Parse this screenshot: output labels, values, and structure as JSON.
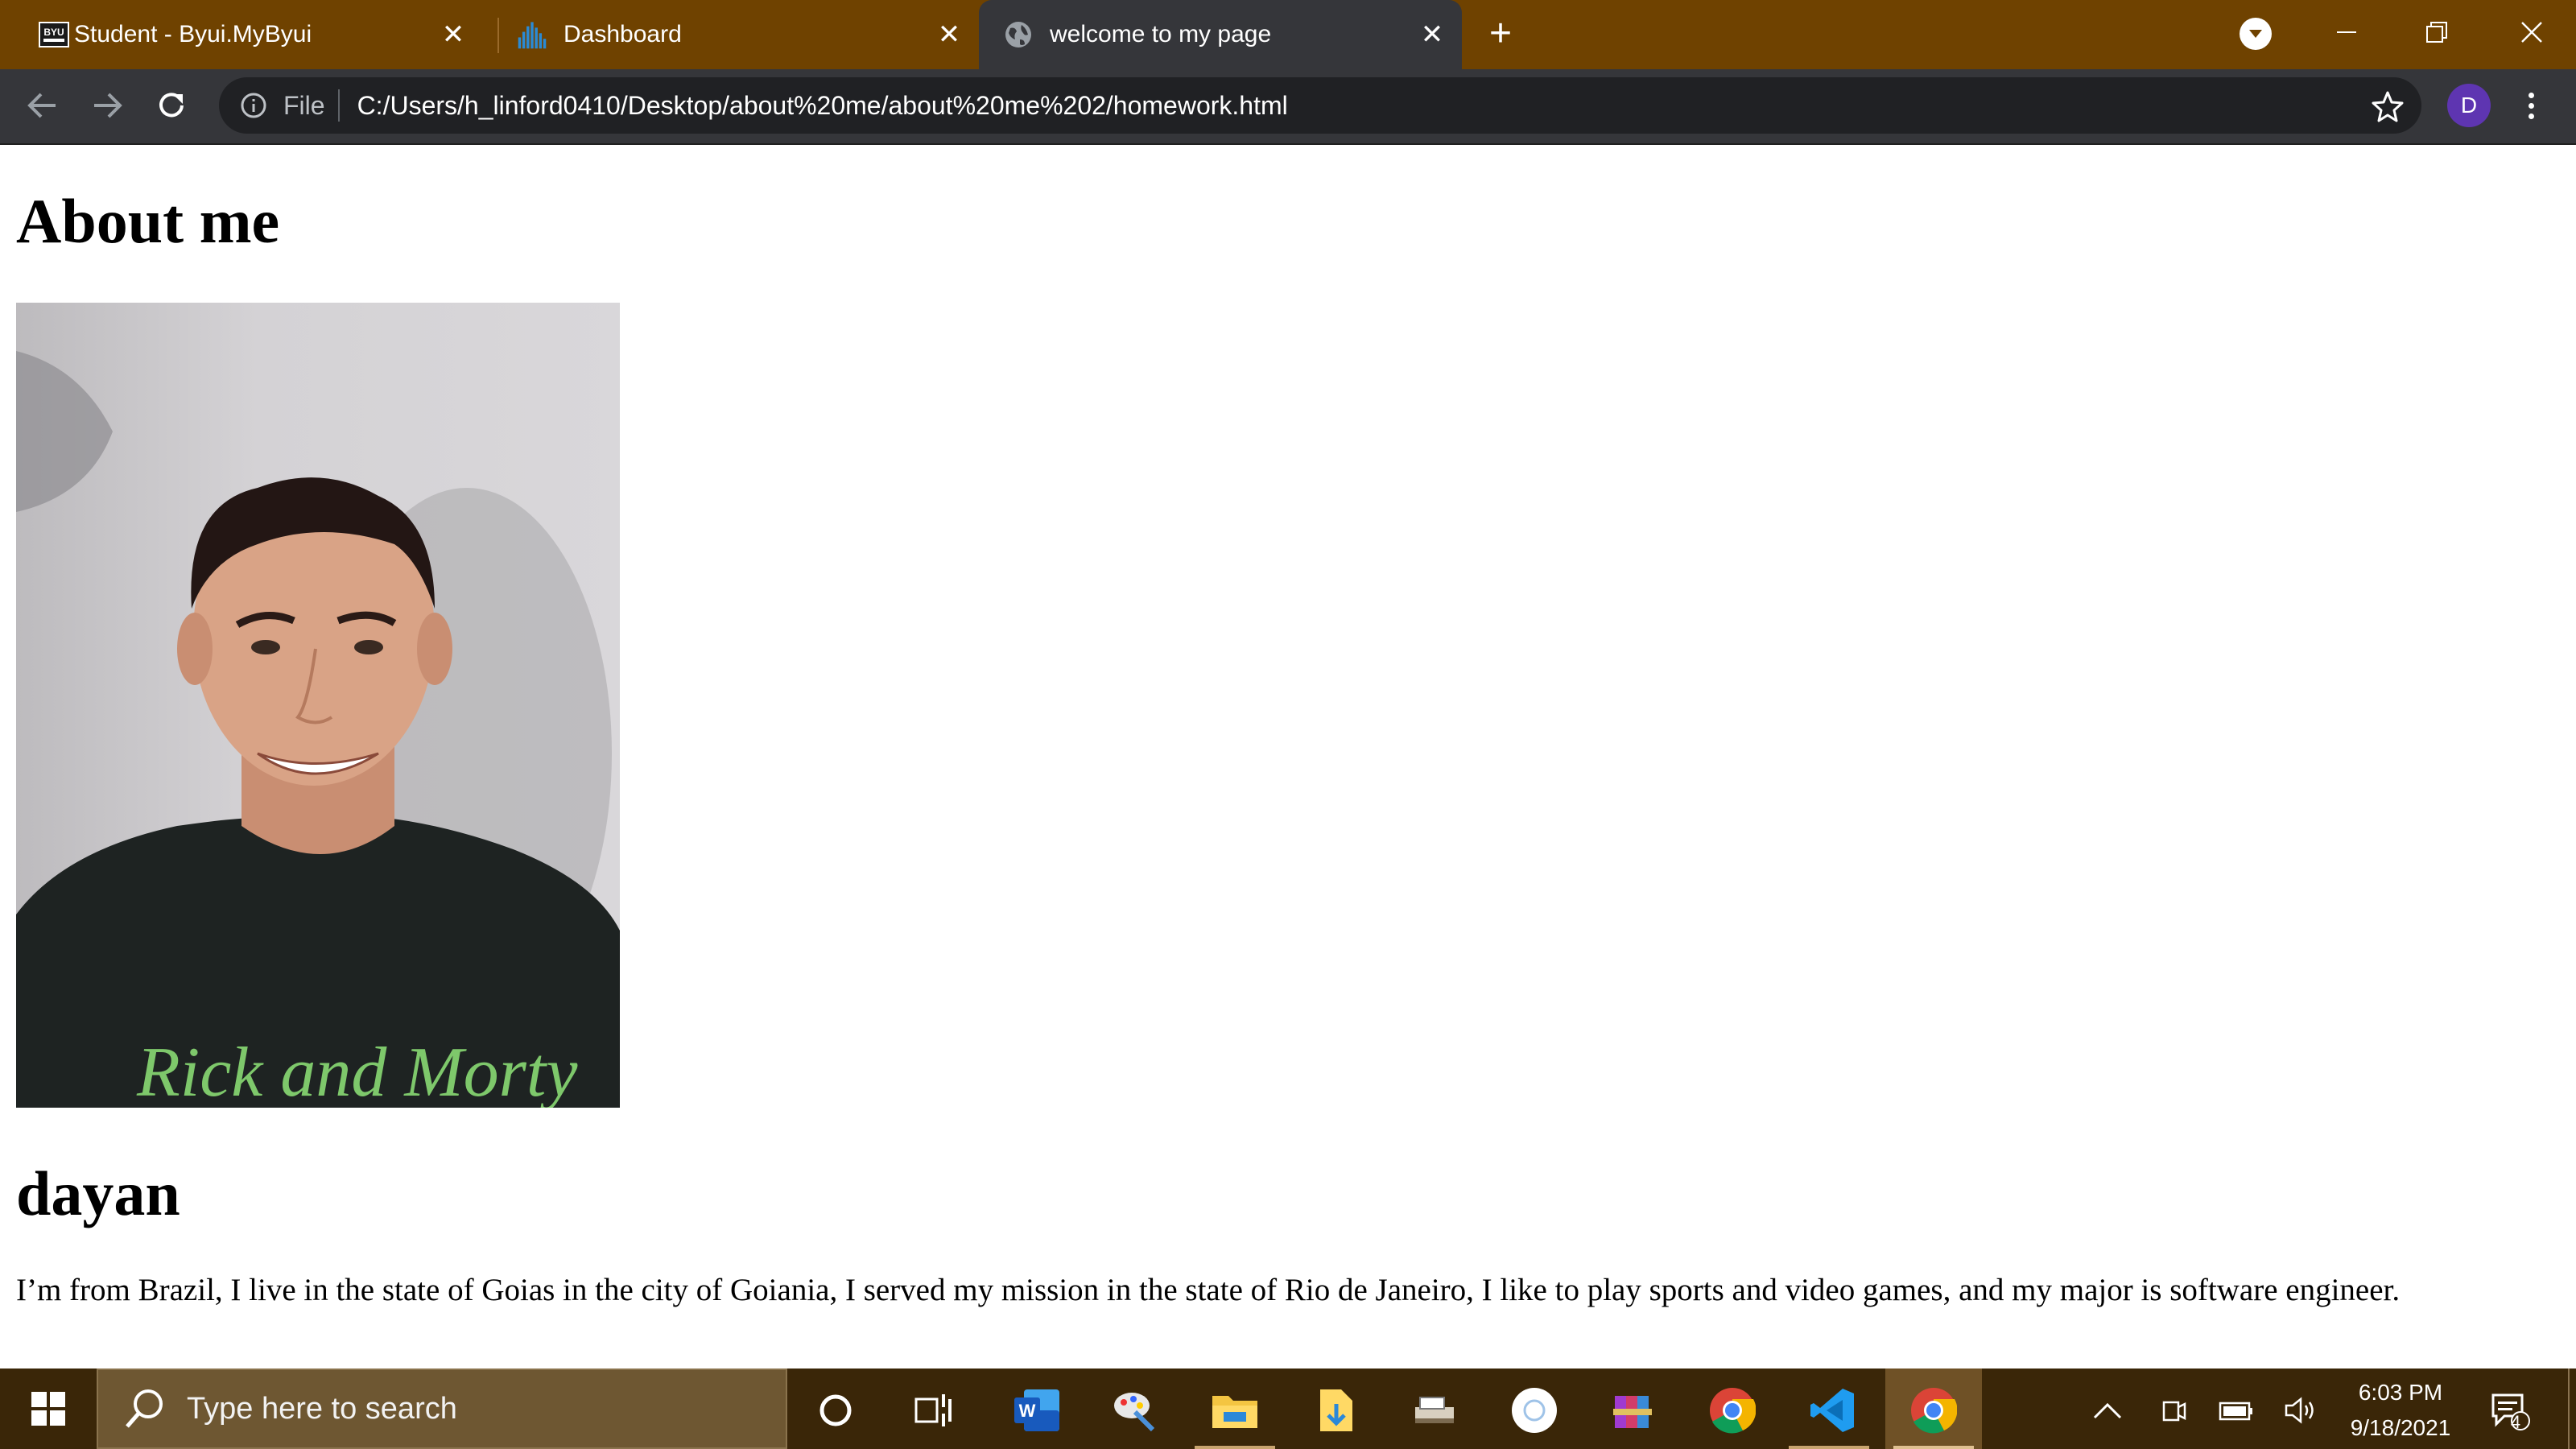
{
  "browser": {
    "tabs": [
      {
        "title": "Student - Byui.MyByui",
        "favicon": "byu-idaho-logo-icon",
        "favicon_text": "BYU",
        "active": false
      },
      {
        "title": "Dashboard",
        "favicon": "bar-chart-icon",
        "active": false
      },
      {
        "title": "welcome to my page",
        "favicon": "globe-icon",
        "active": true
      }
    ],
    "address": {
      "scheme_label": "File",
      "url": "C:/Users/h_linford0410/Desktop/about%20me/about%20me%202/homework.html"
    },
    "profile_initial": "D",
    "colors": {
      "frame": "#6f4200",
      "toolbar": "#35363a",
      "omnibox": "#202124",
      "avatar": "#5e35b1"
    }
  },
  "page": {
    "heading": "About me",
    "photo": {
      "icon": "portrait-photo",
      "shirt_text": "Rick and Morty"
    },
    "name": "dayan",
    "bio": "I’m from Brazil, I live in the state of Goias in the city of Goiania, I served my mission in the state of Rio de Janeiro, I like to play sports and video games, and my major is software engineer."
  },
  "taskbar": {
    "search_placeholder": "Type here to search",
    "apps": [
      "cortana-icon",
      "task-view-icon",
      "word-icon",
      "paint-icon",
      "file-explorer-icon",
      "downloads-folder-icon",
      "scanner-icon",
      "dropbox-like-icon",
      "winrar-icon",
      "chrome-icon",
      "vscode-icon",
      "chrome-active-icon"
    ],
    "clock": {
      "time": "6:03 PM",
      "date": "9/18/2021"
    },
    "notification_count": "4",
    "colors": {
      "bar": "#3a2608",
      "search": "#6e5732"
    }
  }
}
